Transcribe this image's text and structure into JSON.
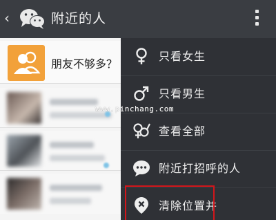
{
  "header": {
    "back_icon": "chevron-left-icon",
    "logo_icon": "wechat-logo-icon",
    "title": "附近的人",
    "more_icon": "more-vertical-icon"
  },
  "list": {
    "banner": {
      "icon": "friends-icon",
      "text": "朋友不够多？"
    }
  },
  "menu": {
    "items": [
      {
        "icon": "female-icon",
        "label": "只看女生"
      },
      {
        "icon": "male-icon",
        "label": "只看男生"
      },
      {
        "icon": "gender-all-icon",
        "label": "查看全部"
      },
      {
        "icon": "chat-bubble-icon",
        "label": "附近打招呼的人"
      },
      {
        "icon": "clear-location-icon",
        "label": "清除位置并"
      }
    ]
  },
  "watermark": "www.pinchang.com",
  "colors": {
    "topbar": "#3a3d42",
    "menu": "#2f3136",
    "highlight": "#d3161b",
    "banner_icon": "#f2a13a"
  }
}
